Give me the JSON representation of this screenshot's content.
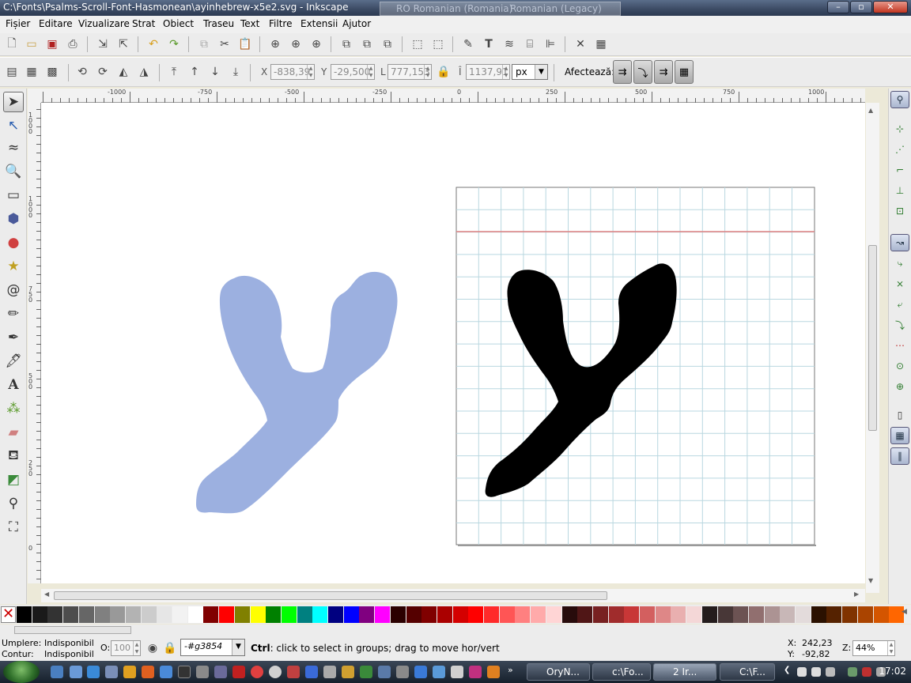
{
  "window": {
    "title": "C:\\Fonts\\Psalms-Scroll-Font-Hasmonean\\ayinhebrew-x5e2.svg - Inkscape",
    "lang_primary": "RO Romanian (Romania)",
    "lang_secondary": "Romanian (Legacy)",
    "minimize": "–",
    "maximize": "▫",
    "close": "✕"
  },
  "menu": [
    {
      "label": "Fișier"
    },
    {
      "label": "Editare"
    },
    {
      "label": "Vizualizare"
    },
    {
      "label": "Strat"
    },
    {
      "label": "Obiect"
    },
    {
      "label": "Traseu"
    },
    {
      "label": "Text"
    },
    {
      "label": "Filtre"
    },
    {
      "label": "Extensii"
    },
    {
      "label": "Ajutor"
    }
  ],
  "toolbar2": {
    "x_label": "X",
    "x_value": "-838,39",
    "y_label": "Y",
    "y_value": "-29,500",
    "w_label": "L",
    "w_value": "777,153",
    "h_label": "Î",
    "h_value": "1137,91",
    "unit": "px",
    "affects_label": "Afectează:"
  },
  "hruler_labels": [
    "-1000",
    "-750",
    "-500",
    "-250",
    "0",
    "250",
    "500",
    "750",
    "1000"
  ],
  "vruler_labels": [
    "1000",
    "1000",
    "750",
    "500",
    "250",
    "0",
    "0"
  ],
  "palette": [
    "#000000",
    "#1a1a1a",
    "#333333",
    "#4d4d4d",
    "#666666",
    "#808080",
    "#999999",
    "#b3b3b3",
    "#cccccc",
    "#e6e6e6",
    "#f2f2f2",
    "#ffffff",
    "#800000",
    "#ff0000",
    "#808000",
    "#ffff00",
    "#008000",
    "#00ff00",
    "#008080",
    "#00ffff",
    "#000080",
    "#0000ff",
    "#800080",
    "#ff00ff",
    "#2b0000",
    "#550000",
    "#800000",
    "#aa0000",
    "#d40000",
    "#ff0000",
    "#ff2a2a",
    "#ff5555",
    "#ff8080",
    "#ffaaaa",
    "#ffd5d5",
    "#280b0b",
    "#501616",
    "#782121",
    "#a02c2c",
    "#c83737",
    "#d35f5f",
    "#de8787",
    "#e9afaf",
    "#f4d7d7",
    "#241c1c",
    "#483737",
    "#6c5353",
    "#916f6f",
    "#ac9393",
    "#c8b7b7",
    "#e3dbdb",
    "#2b1100",
    "#552200",
    "#803300",
    "#aa4400",
    "#d45500",
    "#ff6600"
  ],
  "status": {
    "fill_label": "Umplere:",
    "fill_value": "Indisponibil",
    "stroke_label": "Contur:",
    "stroke_value": "Indisponibil",
    "opacity_label": "O:",
    "opacity_value": "100",
    "layer_value": "-#g3854",
    "message_bold": "Ctrl",
    "message": ": click to select in groups; drag to move hor/vert",
    "x_label": "X:",
    "x_value": "242,23",
    "y_label": "Y:",
    "y_value": "-92,82",
    "zoom_label": "Z:",
    "zoom_value": "44%"
  },
  "taskbar": {
    "tasks": [
      "OryN...",
      "c:\\Fo...",
      "2 Ir...",
      "C:\\F..."
    ],
    "clock": "17:02"
  },
  "colors": {
    "shape_left": "#9cb0e0",
    "shape_right": "#000000",
    "grid": "#b9d7e0",
    "baseline": "#e08080"
  }
}
